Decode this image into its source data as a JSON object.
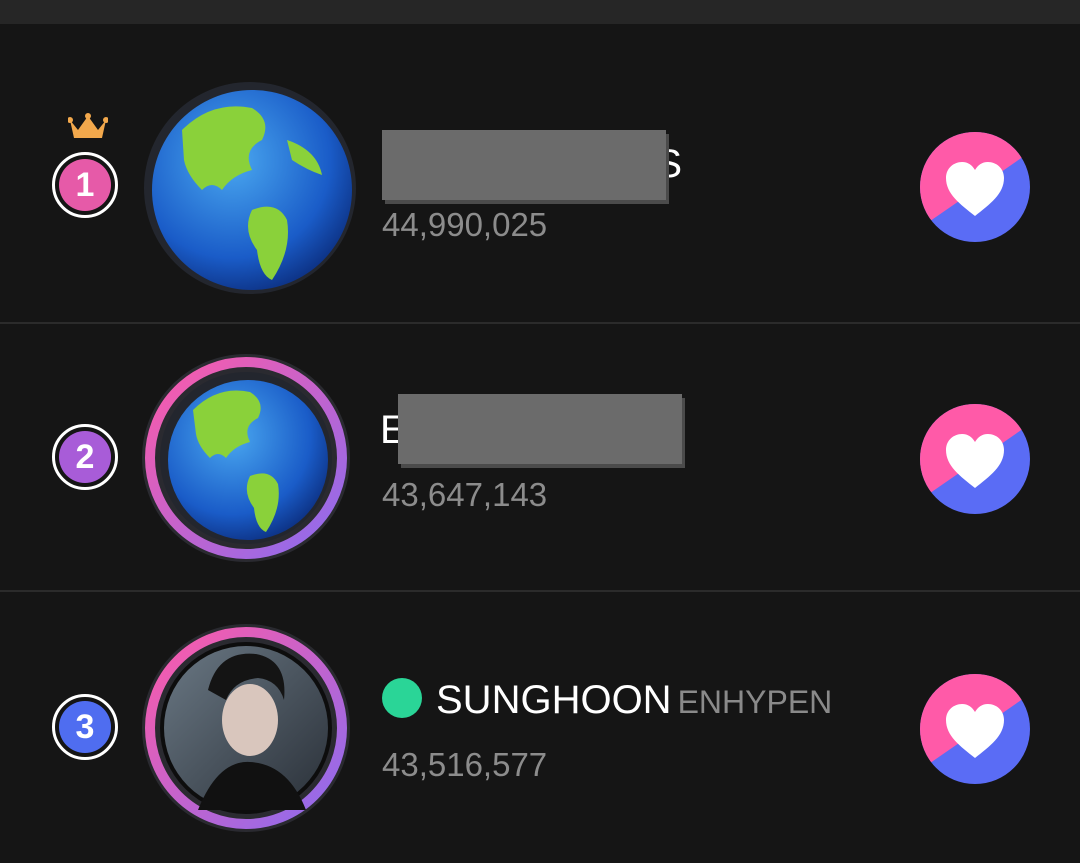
{
  "ranking": [
    {
      "rank": "1",
      "rank_color": "#e65aa8",
      "name_visible": "S",
      "group": "",
      "votes": "44,990,025",
      "avatar": "globe-icon",
      "vote_button": "heart-icon"
    },
    {
      "rank": "2",
      "rank_color": "#a85cd8",
      "name_visible": "E",
      "group": "",
      "votes": "43,647,143",
      "avatar": "globe-icon",
      "vote_button": "heart-icon"
    },
    {
      "rank": "3",
      "rank_color": "#4f6df0",
      "name_visible": "SUNGHOON",
      "group": "ENHYPEN",
      "votes": "43,516,577",
      "avatar": "profile-photo",
      "vote_button": "heart-icon"
    }
  ],
  "colors": {
    "background": "#151515",
    "pink": "#ff5aa8",
    "blue": "#5a6cf5",
    "ring_pink": "#d55ac8",
    "ring_purple": "#8a6cf0",
    "votes_gray": "#8c8c8c"
  }
}
